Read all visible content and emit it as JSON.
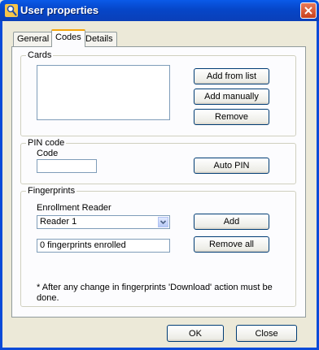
{
  "window": {
    "title": "User properties"
  },
  "tabs": [
    {
      "label": "General"
    },
    {
      "label": "Codes"
    },
    {
      "label": "Details"
    }
  ],
  "cards": {
    "title": "Cards",
    "add_from_list": "Add from list",
    "add_manually": "Add manually",
    "remove": "Remove"
  },
  "pin": {
    "title": "PIN code",
    "code_label": "Code",
    "code_value": "",
    "auto_pin": "Auto PIN"
  },
  "fingerprints": {
    "title": "Fingerprints",
    "reader_label": "Enrollment Reader",
    "reader_selected": "Reader 1",
    "add": "Add",
    "status_value": "0 fingerprints enrolled",
    "remove_all": "Remove all",
    "note": "* After any change in fingerprints 'Download' action must be done."
  },
  "footer": {
    "ok": "OK",
    "close": "Close"
  },
  "colors": {
    "titlebar": "#0a5ae8",
    "dialog_bg": "#ece9d8",
    "panel_bg": "#fcfcfe"
  }
}
